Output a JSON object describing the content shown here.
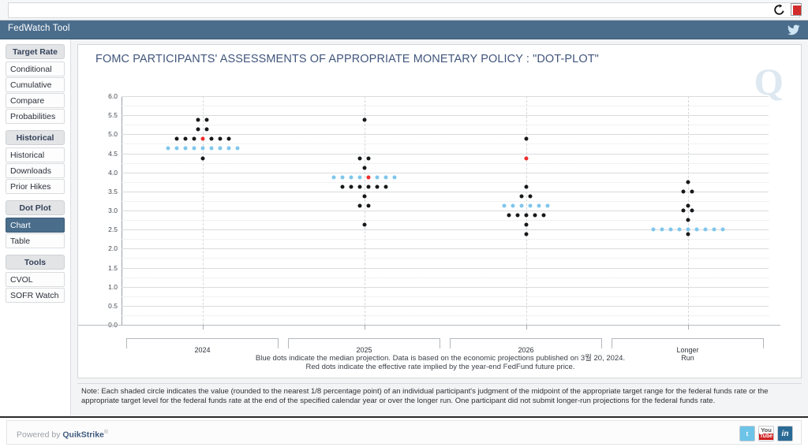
{
  "window": {
    "title": "FedWatch Tool",
    "icons": {
      "refresh": "refresh-icon",
      "pdf": "pdf-icon",
      "twitter": "twitter-icon"
    }
  },
  "sidebar": {
    "groups": [
      {
        "header": "Target Rate",
        "items": [
          {
            "label": "Conditional",
            "active": false
          },
          {
            "label": "Cumulative",
            "active": false
          },
          {
            "label": "Compare",
            "active": false
          },
          {
            "label": "Probabilities",
            "active": false
          }
        ]
      },
      {
        "header": "Historical",
        "items": [
          {
            "label": "Historical",
            "active": false
          },
          {
            "label": "Downloads",
            "active": false
          },
          {
            "label": "Prior Hikes",
            "active": false
          }
        ]
      },
      {
        "header": "Dot Plot",
        "items": [
          {
            "label": "Chart",
            "active": true
          },
          {
            "label": "Table",
            "active": false
          }
        ]
      },
      {
        "header": "Tools",
        "items": [
          {
            "label": "CVOL",
            "active": false
          },
          {
            "label": "SOFR Watch",
            "active": false
          }
        ]
      }
    ]
  },
  "chart_data": {
    "type": "scatter",
    "title": "FOMC PARTICIPANTS' ASSESSMENTS OF APPROPRIATE MONETARY POLICY : \"DOT-PLOT\"",
    "xlabel": "",
    "ylabel": "",
    "ylim": [
      0.0,
      6.0
    ],
    "ytick_step": 0.5,
    "yticks": [
      "0.0",
      "0.5",
      "1.0",
      "1.5",
      "2.0",
      "2.5",
      "3.0",
      "3.5",
      "4.0",
      "4.5",
      "5.0",
      "5.5",
      "6.0"
    ],
    "grid": true,
    "legend_position": "below-caption",
    "categories": [
      "2024",
      "2025",
      "2026",
      "Longer Run"
    ],
    "colors": {
      "participant": "#17181a",
      "median": "#7fc6ec",
      "implied": "#ee2b2b"
    },
    "series": [
      {
        "name": "2024",
        "category_index": 0,
        "levels": [
          {
            "value": 5.375,
            "black": 2,
            "blue": 0,
            "red": 0
          },
          {
            "value": 5.125,
            "black": 2,
            "blue": 0,
            "red": 0
          },
          {
            "value": 4.875,
            "black": 6,
            "blue": 0,
            "red": 1
          },
          {
            "value": 4.625,
            "black": 0,
            "blue": 9,
            "red": 0
          },
          {
            "value": 4.375,
            "black": 1,
            "blue": 0,
            "red": 0
          }
        ]
      },
      {
        "name": "2025",
        "category_index": 1,
        "levels": [
          {
            "value": 5.375,
            "black": 1,
            "blue": 0,
            "red": 0
          },
          {
            "value": 4.375,
            "black": 2,
            "blue": 0,
            "red": 0
          },
          {
            "value": 4.125,
            "black": 1,
            "blue": 0,
            "red": 0
          },
          {
            "value": 3.875,
            "black": 0,
            "blue": 7,
            "red": 1
          },
          {
            "value": 3.625,
            "black": 6,
            "blue": 0,
            "red": 0
          },
          {
            "value": 3.375,
            "black": 1,
            "blue": 0,
            "red": 0
          },
          {
            "value": 3.125,
            "black": 2,
            "blue": 0,
            "red": 0
          },
          {
            "value": 2.625,
            "black": 1,
            "blue": 0,
            "red": 0
          }
        ]
      },
      {
        "name": "2026",
        "category_index": 2,
        "levels": [
          {
            "value": 4.875,
            "black": 1,
            "blue": 0,
            "red": 0
          },
          {
            "value": 4.375,
            "black": 0,
            "blue": 0,
            "red": 1
          },
          {
            "value": 3.625,
            "black": 1,
            "blue": 0,
            "red": 0
          },
          {
            "value": 3.375,
            "black": 2,
            "blue": 0,
            "red": 0
          },
          {
            "value": 3.125,
            "black": 0,
            "blue": 6,
            "red": 0
          },
          {
            "value": 2.875,
            "black": 5,
            "blue": 0,
            "red": 0
          },
          {
            "value": 2.625,
            "black": 1,
            "blue": 0,
            "red": 0
          },
          {
            "value": 2.375,
            "black": 1,
            "blue": 0,
            "red": 0
          }
        ]
      },
      {
        "name": "Longer Run",
        "category_index": 3,
        "levels": [
          {
            "value": 3.75,
            "black": 1,
            "blue": 0,
            "red": 0
          },
          {
            "value": 3.5,
            "black": 2,
            "blue": 0,
            "red": 0
          },
          {
            "value": 3.125,
            "black": 1,
            "blue": 0,
            "red": 0
          },
          {
            "value": 3.0,
            "black": 2,
            "blue": 0,
            "red": 0
          },
          {
            "value": 2.75,
            "black": 1,
            "blue": 0,
            "red": 0
          },
          {
            "value": 2.5,
            "black": 0,
            "blue": 9,
            "red": 0
          },
          {
            "value": 2.375,
            "black": 1,
            "blue": 0,
            "red": 0
          }
        ]
      }
    ],
    "caption_line_1": "Blue dots indicate the median projection. Data is based on the economic projections published on 3월 20, 2024.",
    "caption_line_2": "Red dots indicate the effective rate implied by the year-end FedFund future price."
  },
  "note": "Note: Each shaded circle indicates the value (rounded to the nearest 1/8 percentage point) of an individual participant's judgment of the midpoint of the appropriate target range for the federal funds rate or the appropriate target level for the federal funds rate at the end of the specified calendar year or over the longer run. One participant did not submit longer-run projections for the federal funds rate.",
  "watermark": "Q",
  "footer": {
    "powered_prefix": "Powered by ",
    "powered_brand": "QuikStrike",
    "powered_mark": "®",
    "social": [
      {
        "name": "twitter-icon",
        "label": "t"
      },
      {
        "name": "youtube-icon",
        "label_top": "You",
        "label_bottom": "Tube"
      },
      {
        "name": "linkedin-icon",
        "label": "in"
      }
    ]
  }
}
